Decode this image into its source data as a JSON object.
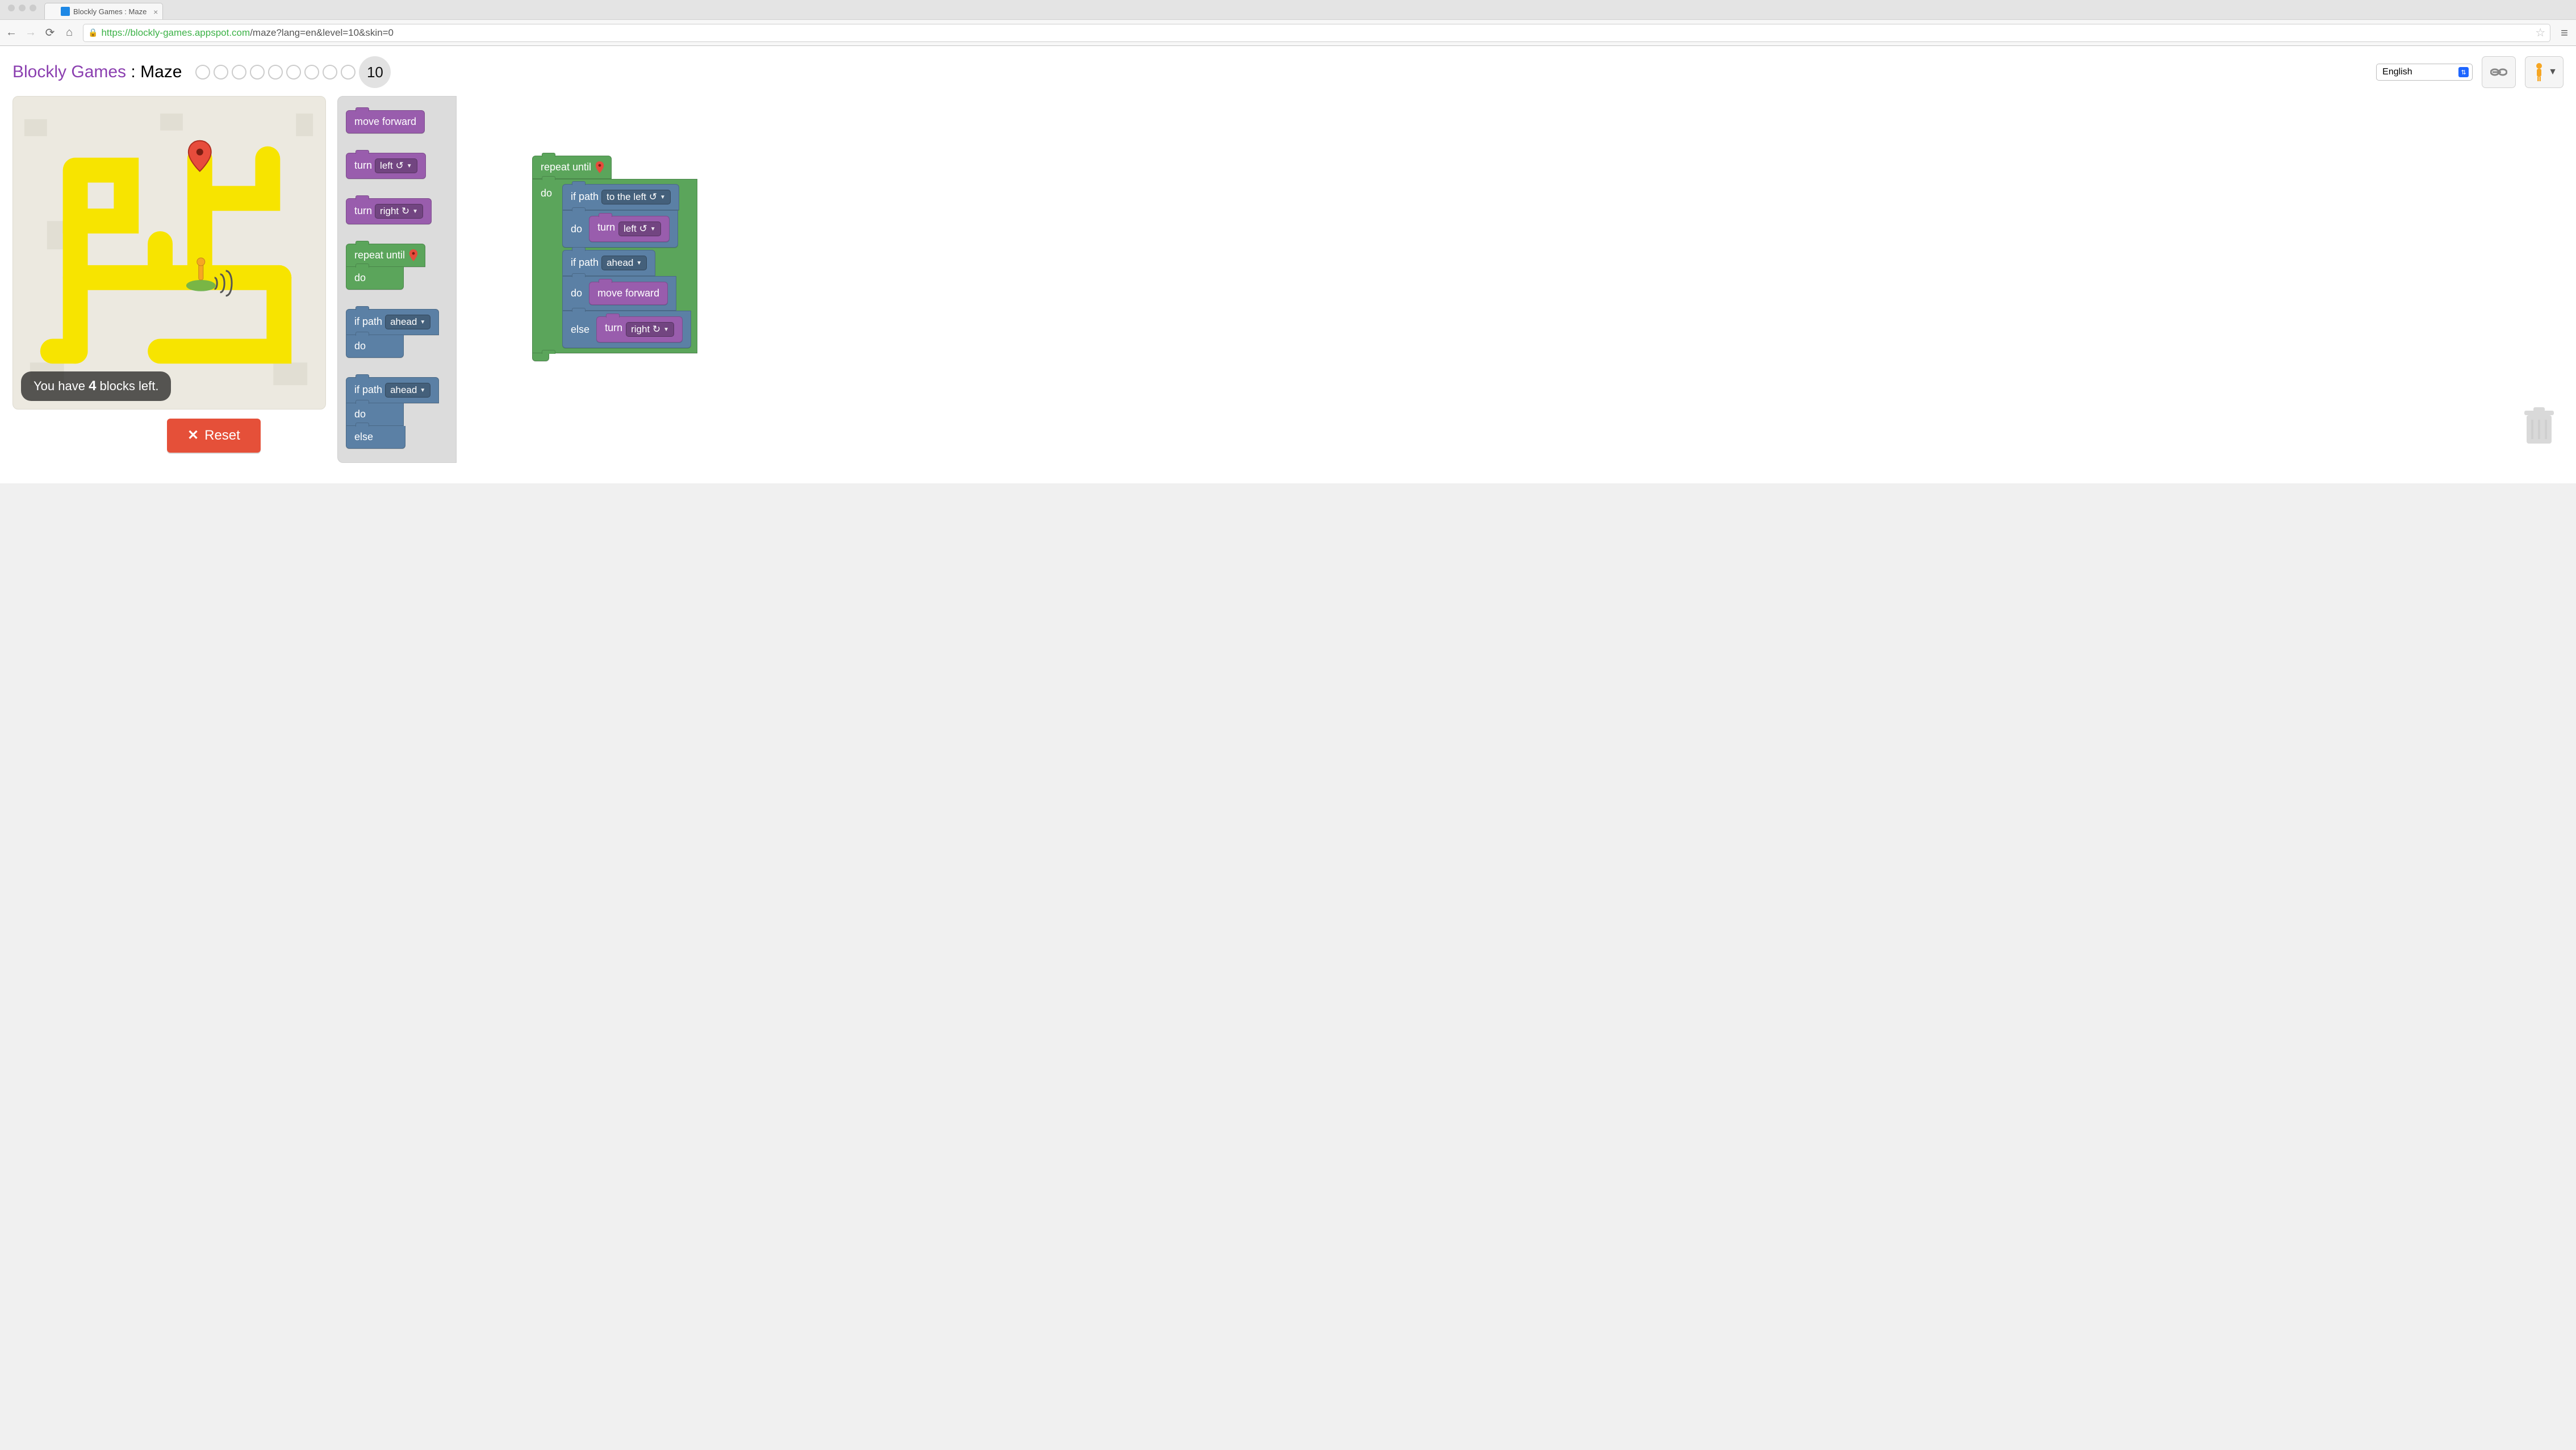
{
  "browser": {
    "tab_title": "Blockly Games : Maze",
    "url_protocol": "https",
    "url_host": "blockly-games.appspot.com",
    "url_path": "/maze?lang=en&level=10&skin=0"
  },
  "header": {
    "brand": "Blockly Games",
    "separator": " : ",
    "game": "Maze",
    "level_count": 10,
    "current_level": "10",
    "language": "English"
  },
  "maze": {
    "status_prefix": "You have ",
    "status_count": "4",
    "status_suffix": " blocks left."
  },
  "controls": {
    "reset_label": "Reset"
  },
  "toolbox": {
    "move_forward": "move forward",
    "turn": "turn",
    "left": "left ↺",
    "right": "right ↻",
    "repeat_until": "repeat until",
    "do": "do",
    "else": "else",
    "if_path": "if path",
    "ahead": "ahead",
    "to_the_left": "to the left ↺"
  }
}
